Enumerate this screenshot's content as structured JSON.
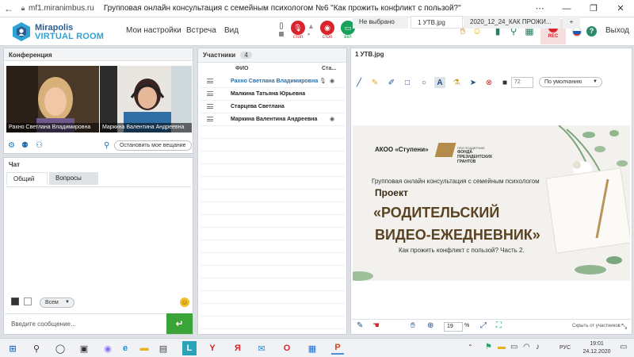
{
  "browser": {
    "url": "mf1.miranimbus.ru",
    "title": "Групповая онлайн консультация с семейным психологом №6 \"Как прожить конфликт с пользой?\""
  },
  "logo": {
    "line1": "Mirapolis",
    "line2": "VIRTUAL ROOM"
  },
  "menu": {
    "settings": "Мои настройки",
    "meeting": "Встреча",
    "view": "Вид"
  },
  "controls": {
    "mic_label": "стоп",
    "cam_label": "стоп",
    "screen_label": "вкл",
    "rec_label": "REC",
    "exit": "Выход"
  },
  "conference": {
    "title": "Конференция",
    "video1_name": "Рахно Светлана  Владимировна",
    "video2_name": "Маркина Валентина  Андреевна",
    "stop_broadcast": "Остановить мое вещание"
  },
  "chat": {
    "title": "Чат",
    "tabs": [
      "Общий",
      "Вопросы"
    ],
    "recipient": "Всем",
    "placeholder": "Введите сообщение..."
  },
  "participants": {
    "title": "Участники",
    "count": "4",
    "col_name": "ФИО",
    "col_status": "Ста...",
    "rows": [
      {
        "name": "Рахно Светлана  Владимировна"
      },
      {
        "name": "Малкина Татьяна  Юрьевна"
      },
      {
        "name": "Старцева  Светлана"
      },
      {
        "name": "Маркина Валентина  Андреевна"
      }
    ]
  },
  "board": {
    "title": "1 УТВ.jpg",
    "tabs": [
      "Не выбрано",
      "1 УТВ.jpg",
      "2020_12_24_КАК ПРОЖИ...",
      "+"
    ],
    "font_size": "72",
    "font_name": "По умолчанию",
    "zoom": "19",
    "zoom_unit": "%",
    "hide_from_participants": "Скрыть от участников"
  },
  "slide": {
    "org": "АКОО «Ступени»",
    "support_line1": "ПРИ ПОДДЕРЖКЕ",
    "support_line2": "ФОНДА",
    "support_line3": "ПРЕЗИДЕНТСКИХ",
    "support_line4": "ГРАНТОВ",
    "subtitle": "Групповая онлайн консультация с семейным психологом",
    "project": "Проект",
    "heading1": "«РОДИТЕЛЬСКИЙ",
    "heading2": "ВИДЕО-ЕЖЕДНЕВНИК»",
    "caption": "Как прожить конфликт с пользой? Часть 2."
  },
  "taskbar": {
    "lang": "РУС",
    "time": "19:01",
    "date": "24.12.2020"
  },
  "colors": {
    "accent_blue": "#2a6fa8",
    "rec_red": "#d9242e",
    "screen_green": "#1aa15a",
    "send_green": "#3aa536",
    "slide_title_brown": "#5a4322"
  }
}
